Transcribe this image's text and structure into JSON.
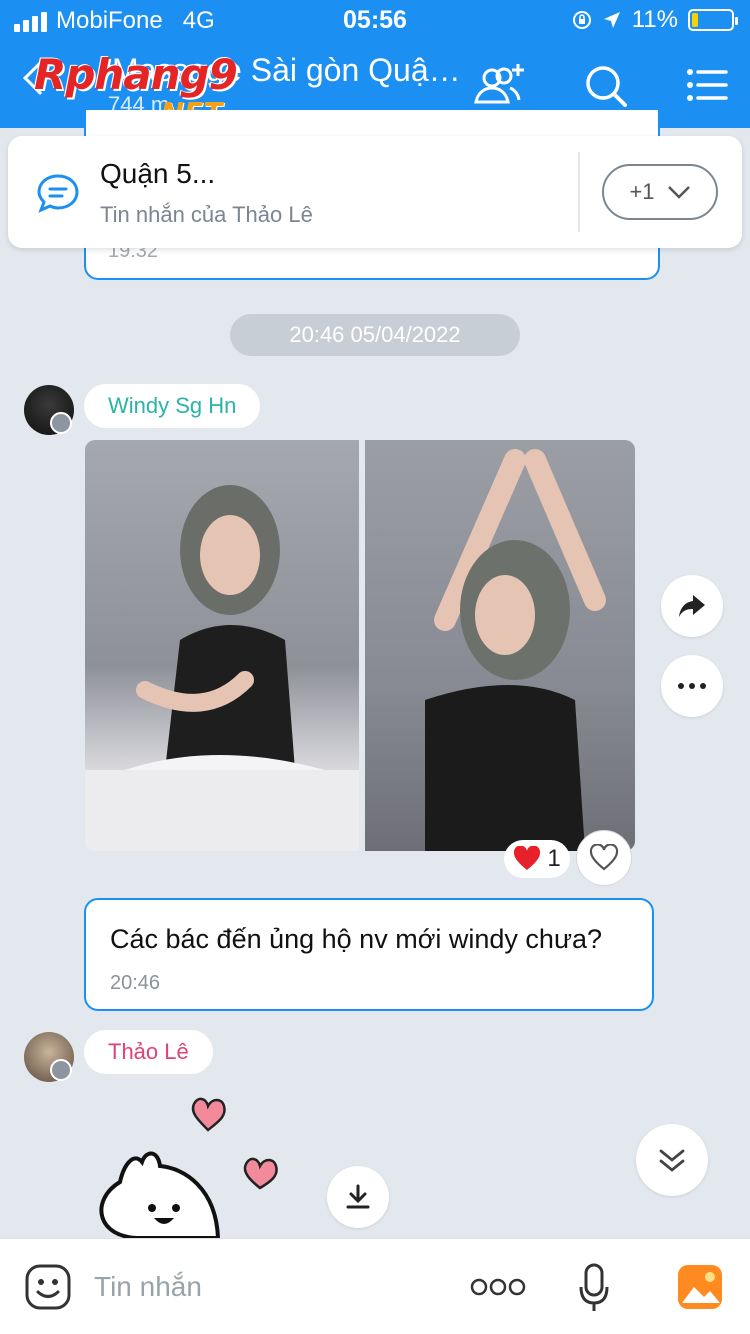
{
  "status_bar": {
    "carrier": "MobiFone",
    "network": "4G",
    "time": "05:56",
    "battery_percent": "11%"
  },
  "header": {
    "title": "Massage Sài gòn Quận...",
    "subtitle": "744 m",
    "watermark_main": "Rphang9",
    "watermark_sub": ".NET"
  },
  "pinned": {
    "title": "Quận 5...",
    "subtitle": "Tin nhắn của Thảo Lê",
    "more_label": "+1"
  },
  "previous_message": {
    "time": "19:32"
  },
  "date_separator": "20:46 05/04/2022",
  "messages": [
    {
      "sender": "Windy Sg Hn",
      "sender_color": "#2bb3a8",
      "reaction_count": "1"
    },
    {
      "text": "Các bác đến ủng hộ nv mới windy chưa?",
      "time": "20:46"
    },
    {
      "sender": "Thảo Lê",
      "sender_color": "#e0427a"
    }
  ],
  "input": {
    "placeholder": "Tin nhắn"
  },
  "colors": {
    "accent": "#1b90f2",
    "background": "#e3e8ef"
  }
}
